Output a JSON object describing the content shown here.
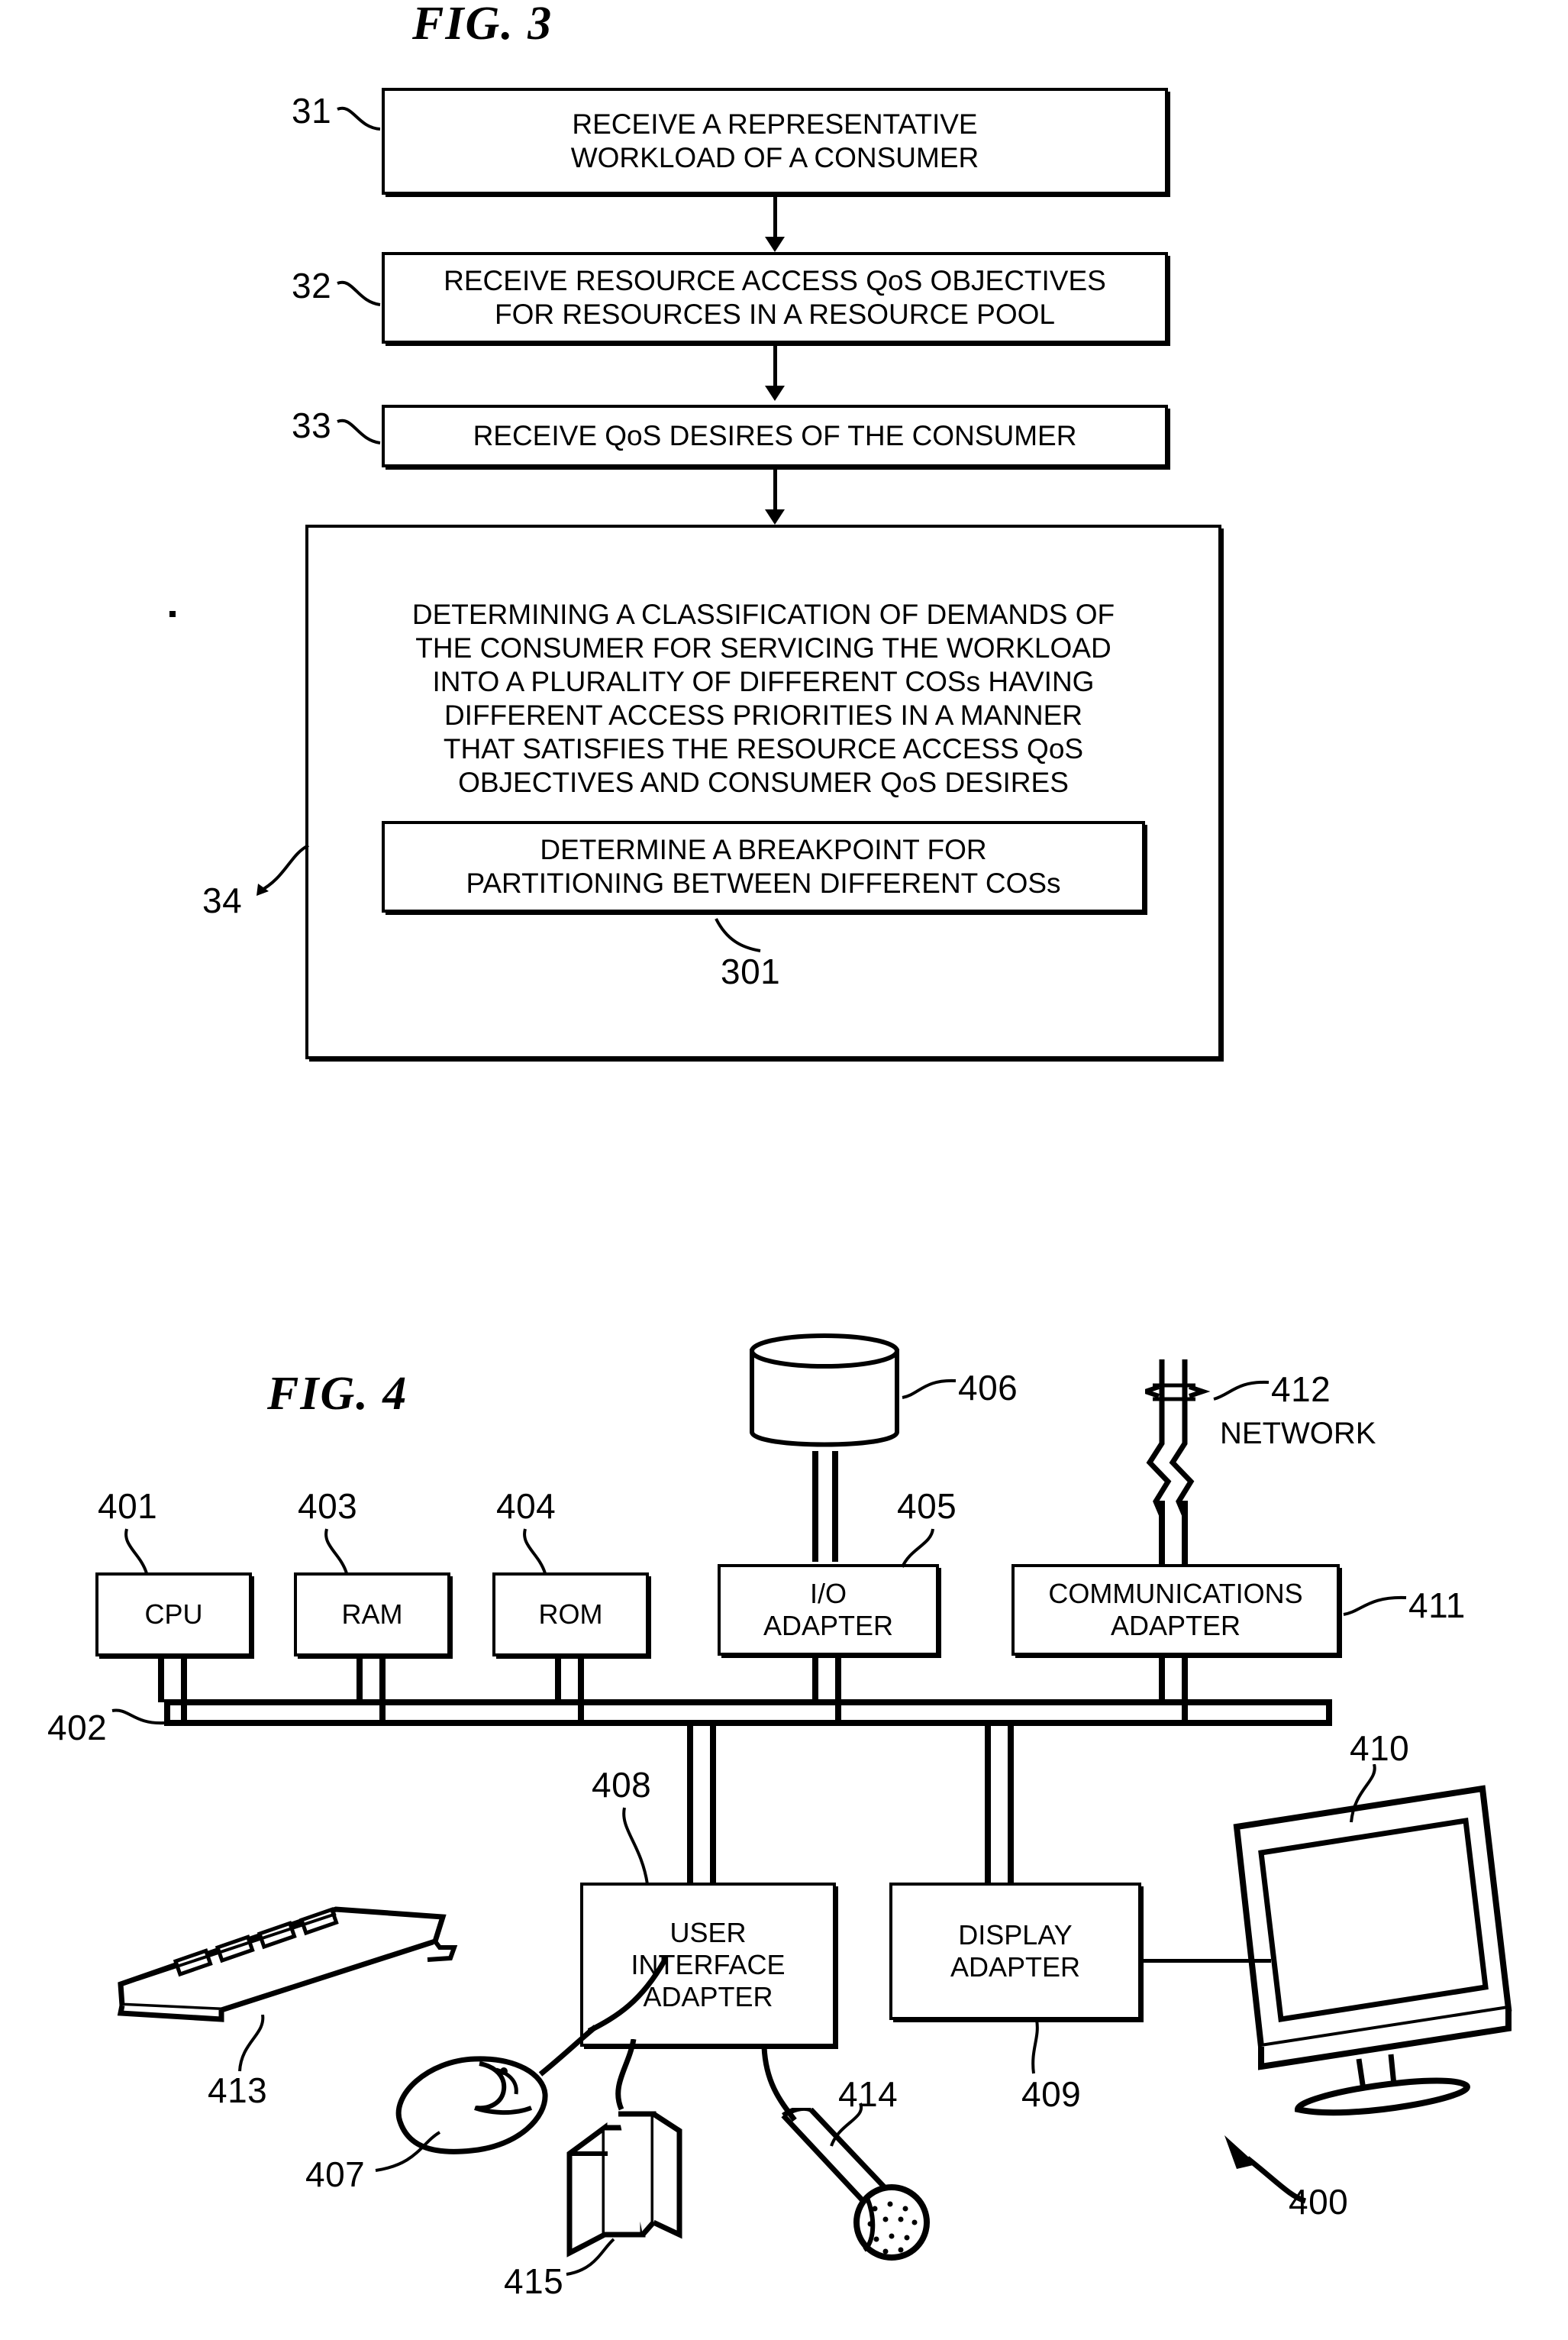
{
  "figures": [
    {
      "id": "fig3",
      "title": "FIG. 3",
      "steps": [
        {
          "ref": "31",
          "text": "RECEIVE A REPRESENTATIVE\nWORKLOAD OF A CONSUMER"
        },
        {
          "ref": "32",
          "text": "RECEIVE RESOURCE ACCESS QoS OBJECTIVES\nFOR RESOURCES IN A RESOURCE POOL"
        },
        {
          "ref": "33",
          "text": "RECEIVE QoS DESIRES OF THE CONSUMER"
        },
        {
          "ref": "34",
          "text": "DETERMINING A CLASSIFICATION OF DEMANDS OF\nTHE CONSUMER FOR SERVICING THE WORKLOAD\nINTO A PLURALITY OF DIFFERENT COSs HAVING\nDIFFERENT ACCESS PRIORITIES IN A MANNER\nTHAT SATISFIES THE RESOURCE ACCESS QoS\nOBJECTIVES AND CONSUMER QoS DESIRES"
        }
      ],
      "inner_step": {
        "ref": "301",
        "text": "DETERMINE A BREAKPOINT FOR\nPARTITIONING BETWEEN DIFFERENT COSs"
      }
    },
    {
      "id": "fig4",
      "title": "FIG. 4",
      "system_ref": "400",
      "components": [
        {
          "ref": "401",
          "label": "CPU"
        },
        {
          "ref": "403",
          "label": "RAM"
        },
        {
          "ref": "404",
          "label": "ROM"
        },
        {
          "ref": "405",
          "label": "I/O\nADAPTER"
        },
        {
          "ref": "411",
          "label": "COMMUNICATIONS\nADAPTER"
        },
        {
          "ref": "408",
          "label": "USER\nINTERFACE\nADAPTER"
        },
        {
          "ref": "409",
          "label": "DISPLAY\nADAPTER"
        }
      ],
      "peripherals": [
        {
          "ref": "406",
          "name": "disk-storage"
        },
        {
          "ref": "402",
          "name": "system-bus"
        },
        {
          "ref": "412",
          "name": "network-link",
          "label": "NETWORK"
        },
        {
          "ref": "413",
          "name": "keyboard"
        },
        {
          "ref": "407",
          "name": "mouse"
        },
        {
          "ref": "415",
          "name": "speakers"
        },
        {
          "ref": "414",
          "name": "microphone"
        },
        {
          "ref": "410",
          "name": "display-monitor"
        }
      ]
    }
  ]
}
